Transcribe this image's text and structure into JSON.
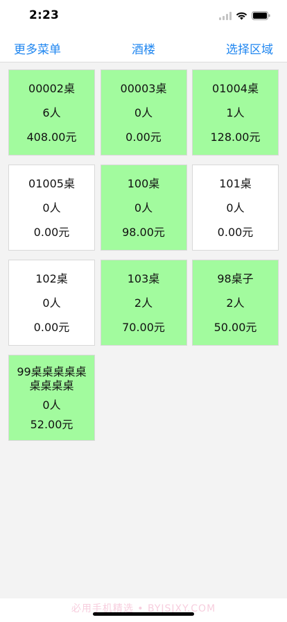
{
  "status_bar": {
    "time": "2:23"
  },
  "nav": {
    "left_label": "更多菜单",
    "title": "酒楼",
    "right_label": "选择区域"
  },
  "tables": [
    {
      "name": "00002桌",
      "guests": "6人",
      "amount": "408.00元",
      "occupied": true
    },
    {
      "name": "00003桌",
      "guests": "0人",
      "amount": "0.00元",
      "occupied": true
    },
    {
      "name": "01004桌",
      "guests": "1人",
      "amount": "128.00元",
      "occupied": true
    },
    {
      "name": "01005桌",
      "guests": "0人",
      "amount": "0.00元",
      "occupied": false
    },
    {
      "name": "100桌",
      "guests": "0人",
      "amount": "98.00元",
      "occupied": true
    },
    {
      "name": "101桌",
      "guests": "0人",
      "amount": "0.00元",
      "occupied": false
    },
    {
      "name": "102桌",
      "guests": "0人",
      "amount": "0.00元",
      "occupied": false
    },
    {
      "name": "103桌",
      "guests": "2人",
      "amount": "70.00元",
      "occupied": true
    },
    {
      "name": "98桌子",
      "guests": "2人",
      "amount": "50.00元",
      "occupied": true
    },
    {
      "name": "99桌桌桌桌桌桌桌桌桌",
      "guests": "0人",
      "amount": "52.00元",
      "occupied": true
    }
  ],
  "colors": {
    "occupied": "#a2fb9e",
    "free": "#ffffff",
    "accent": "#1f86f0"
  },
  "watermark": "必用手机精选 • BYJSJXY.COM"
}
